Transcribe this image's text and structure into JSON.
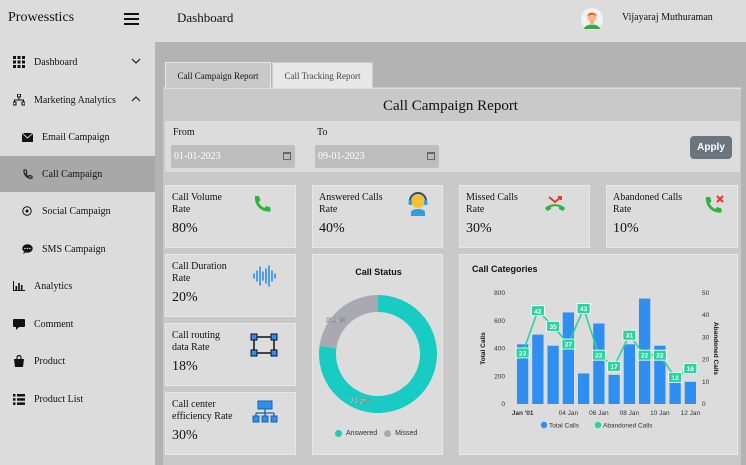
{
  "brand": "Prowesstics",
  "topbar": {
    "title": "Dashboard",
    "username": "Vijayaraj Muthuraman"
  },
  "sidebar": {
    "items": [
      {
        "label": "Dashboard",
        "icon": "grid-icon"
      },
      {
        "label": "Marketing Analytics",
        "icon": "sitemap-icon"
      },
      {
        "label": "Email Campaign",
        "icon": "envelope-icon"
      },
      {
        "label": "Call Campaign",
        "icon": "phone-icon"
      },
      {
        "label": "Social Campaign",
        "icon": "social-icon"
      },
      {
        "label": "SMS Campaign",
        "icon": "sms-icon"
      },
      {
        "label": "Analytics",
        "icon": "bar-chart-icon"
      },
      {
        "label": "Comment",
        "icon": "comment-icon"
      },
      {
        "label": "Product",
        "icon": "bag-icon"
      },
      {
        "label": "Product List",
        "icon": "list-icon"
      }
    ]
  },
  "tabs": [
    "Call Campaign Report",
    "Call Tracking Report"
  ],
  "report_title": "Call Campaign Report",
  "filters": {
    "from_label": "From",
    "from_value": "01-01-2023",
    "to_label": "To",
    "to_value": "09-01-2023",
    "apply_label": "Apply"
  },
  "cards": {
    "volume": {
      "label1": "Call Volume",
      "label2": "Rate",
      "value": "80%"
    },
    "answered": {
      "label1": "Answered Calls",
      "label2": "Rate",
      "value": "40%"
    },
    "missed": {
      "label1": "Missed Calls",
      "label2": "Rate",
      "value": "30%"
    },
    "abandoned": {
      "label1": "Abandoned Calls",
      "label2": "Rate",
      "value": "10%"
    },
    "duration": {
      "label1": "Call Duration",
      "label2": "Rate",
      "value": "20%"
    },
    "routing": {
      "label1": "Call routing",
      "label2": "data Rate",
      "value": "18%"
    },
    "efficiency": {
      "label1": "Call center",
      "label2": "efficiency Rate",
      "value": "30%"
    }
  },
  "colors": {
    "teal": "#18ccc4",
    "grey": "#a9a9b3",
    "blue": "#2e8ff0",
    "green": "#2ad49c"
  },
  "chart_data": [
    {
      "type": "pie",
      "title": "Call Status",
      "labels": [
        "Answered",
        "Missed"
      ],
      "values": [
        77.2,
        22.8
      ],
      "value_labels": [
        "77.2%",
        "22.8%"
      ],
      "legend": "bottom"
    },
    {
      "type": "bar",
      "title": "Call Categories",
      "ylabel": "Total Calls",
      "y2label": "Abandoned Calls",
      "ylim": [
        0,
        800
      ],
      "y2lim": [
        0,
        50
      ],
      "yticks": [
        "0",
        "200",
        "400",
        "600",
        "800"
      ],
      "y2ticks": [
        "0",
        "10",
        "20",
        "30",
        "40",
        "50"
      ],
      "xticks": [
        "Jan '01",
        "04 Jan",
        "06 Jan",
        "08 Jan",
        "10 Jan",
        "12 Jan"
      ],
      "series": [
        {
          "name": "Total Calls",
          "type": "bar",
          "values": [
            430,
            500,
            420,
            660,
            220,
            580,
            210,
            430,
            760,
            420,
            200,
            160
          ]
        },
        {
          "name": "Abandoned Calls",
          "type": "line",
          "values": [
            23,
            42,
            35,
            27,
            43,
            22,
            17,
            31,
            22,
            22,
            12,
            16
          ]
        }
      ],
      "legend": "bottom"
    }
  ]
}
